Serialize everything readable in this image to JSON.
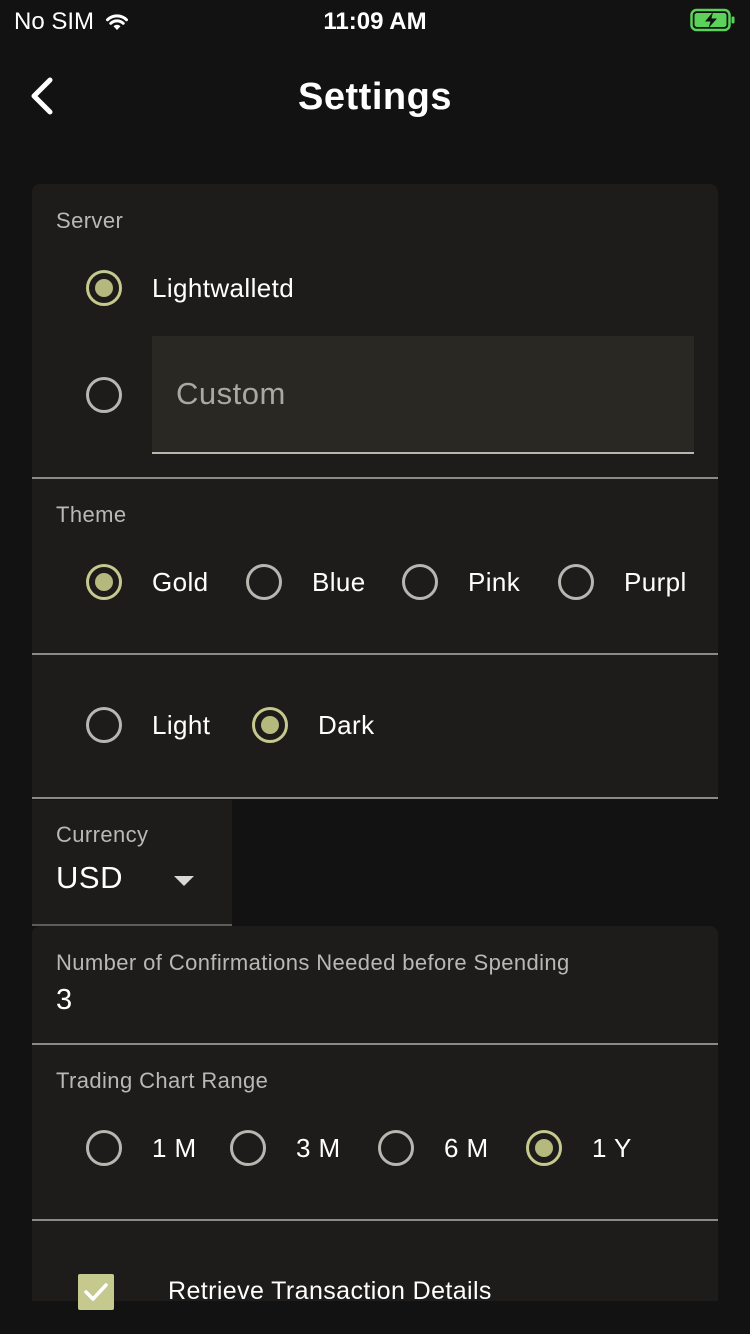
{
  "status_bar": {
    "carrier": "No SIM",
    "time": "11:09 AM",
    "icons": [
      "wifi-icon",
      "battery-charging-icon"
    ]
  },
  "nav": {
    "title": "Settings",
    "back_icon": "chevron-left-icon"
  },
  "server": {
    "label": "Server",
    "options": [
      {
        "label": "Lightwalletd",
        "checked": true
      },
      {
        "label": "",
        "checked": false
      }
    ],
    "custom_placeholder": "Custom"
  },
  "theme": {
    "label": "Theme",
    "options": [
      {
        "label": "Gold",
        "checked": true
      },
      {
        "label": "Blue",
        "checked": false
      },
      {
        "label": "Pink",
        "checked": false
      },
      {
        "label": "Purpl",
        "checked": false
      }
    ],
    "modes": [
      {
        "label": "Light",
        "checked": false
      },
      {
        "label": "Dark",
        "checked": true
      }
    ]
  },
  "currency": {
    "label": "Currency",
    "value": "USD"
  },
  "confirmations": {
    "label": "Number of Confirmations Needed before Spending",
    "value": "3"
  },
  "chart_range": {
    "label": "Trading Chart Range",
    "options": [
      {
        "label": "1 M",
        "checked": false
      },
      {
        "label": "3 M",
        "checked": false
      },
      {
        "label": "6 M",
        "checked": false
      },
      {
        "label": "1 Y",
        "checked": true
      }
    ]
  },
  "retrieve_details": {
    "label": "Retrieve Transaction Details",
    "checked": true
  },
  "colors": {
    "accent": "#c5c98e",
    "card_bg": "#1d1c1a",
    "page_bg": "#121212"
  }
}
